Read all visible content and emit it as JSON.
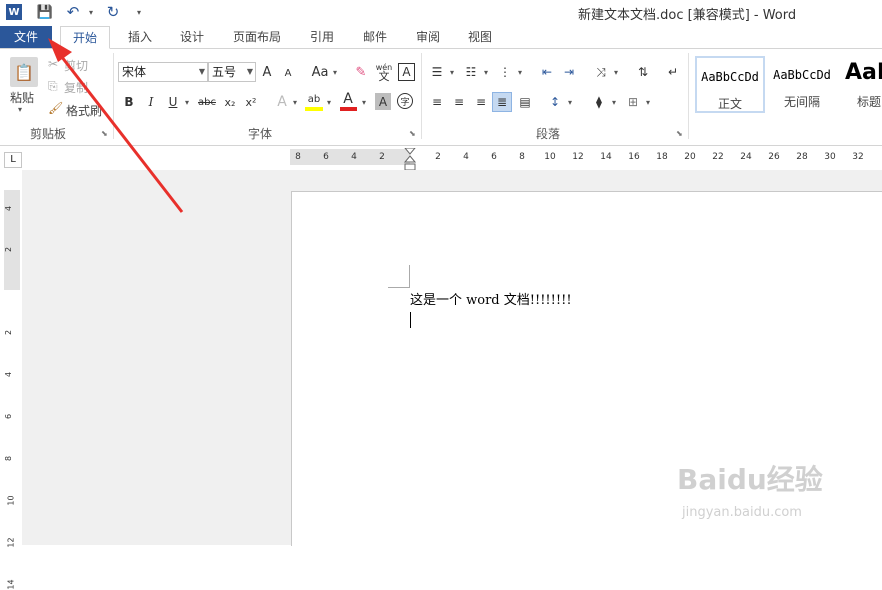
{
  "window": {
    "title": "新建文本文档.doc [兼容模式] - Word"
  },
  "qat": {
    "word_icon": "word-icon",
    "save_icon": "save-icon",
    "undo_icon": "undo-icon",
    "redo_icon": "redo-icon",
    "customize_icon": "customize-icon"
  },
  "tabs": [
    {
      "label": "文件"
    },
    {
      "label": "开始"
    },
    {
      "label": "插入"
    },
    {
      "label": "设计"
    },
    {
      "label": "页面布局"
    },
    {
      "label": "引用"
    },
    {
      "label": "邮件"
    },
    {
      "label": "审阅"
    },
    {
      "label": "视图"
    }
  ],
  "clipboard": {
    "paste": "粘贴",
    "cut": "剪切",
    "copy": "复制",
    "format_painter": "格式刷",
    "group": "剪贴板"
  },
  "font": {
    "name": "宋体",
    "size": "五号",
    "group": "字体",
    "grow": "A",
    "shrink": "A",
    "case": "Aa",
    "bold": "B",
    "italic": "I",
    "underline": "U",
    "strike": "abc",
    "sub": "x₂",
    "sup": "x²",
    "effects": "A",
    "highlight": "ab",
    "color": "A",
    "shading": "A",
    "enclose": "字",
    "phonetic": "wén",
    "border_char": "A"
  },
  "paragraph": {
    "group": "段落"
  },
  "styles": [
    {
      "sample": "AaBbCcDd",
      "name": "正文"
    },
    {
      "sample": "AaBbCcDd",
      "name": "无间隔"
    },
    {
      "sample": "AaI",
      "name": "标题"
    }
  ],
  "ruler": {
    "tab_selector": "L",
    "h_left": [
      "8",
      "6",
      "4",
      "2"
    ],
    "h_right": [
      "2",
      "4",
      "6",
      "8",
      "10",
      "12",
      "14",
      "16",
      "18",
      "20",
      "22",
      "24",
      "26",
      "28",
      "30",
      "32"
    ],
    "v_top": [
      "4",
      "2"
    ],
    "v_bottom": [
      "2",
      "4",
      "6",
      "8",
      "10",
      "12",
      "14"
    ]
  },
  "document": {
    "text": "这是一个 word 文档!!!!!!!!"
  },
  "watermark": {
    "main": "Baidu经验",
    "sub": "jingyan.baidu.com"
  },
  "colors": {
    "file_tab": "#2b579a",
    "arrow": "#e8302b",
    "highlight": "#ffff00",
    "font_color": "#e02020"
  }
}
